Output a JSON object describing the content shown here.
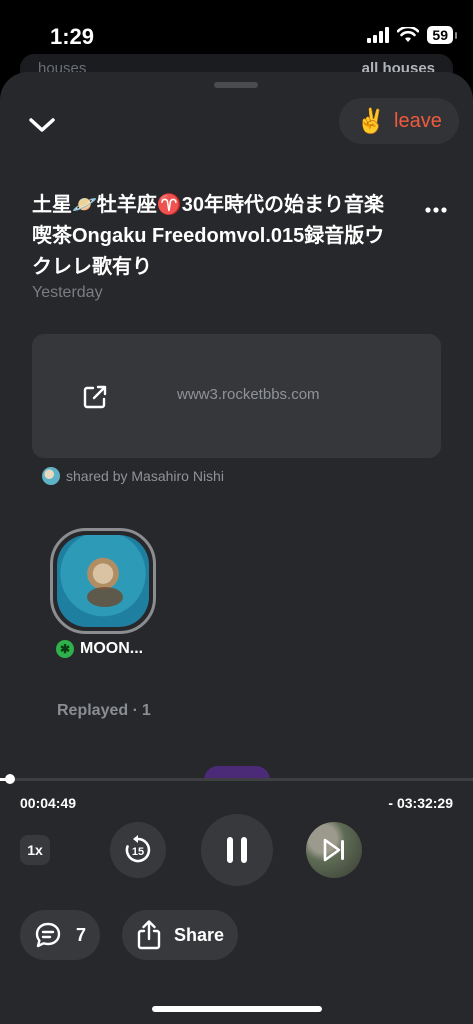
{
  "status_bar": {
    "time": "1:29",
    "battery": "59"
  },
  "background_card": {
    "left_text": "houses",
    "right_link": "all houses"
  },
  "header": {
    "leave_emoji": "✌️",
    "leave_label": "leave"
  },
  "post": {
    "title": "土星🪐牡羊座♈️30年時代の始まり音楽喫茶Ongaku Freedomvol.015録音版ウクレレ歌有り",
    "date": "Yesterday",
    "link_url": "www3.rocketbbs.com",
    "shared_by": "shared by Masahiro Nishi"
  },
  "speaker": {
    "name": "MOON...",
    "badge": "✱"
  },
  "replayed": {
    "label": "Replayed ·",
    "count": "1"
  },
  "player": {
    "elapsed": "00:04:49",
    "remaining": "- 03:32:29",
    "progress_fraction": 0.022,
    "speed": "1x",
    "rewind_seconds": "15"
  },
  "actions": {
    "comments_count": "7",
    "share_label": "Share"
  },
  "colors": {
    "accent_leave": "#ef5a3e",
    "sheet_bg": "#27282b",
    "badge_green": "#2fb14b"
  }
}
